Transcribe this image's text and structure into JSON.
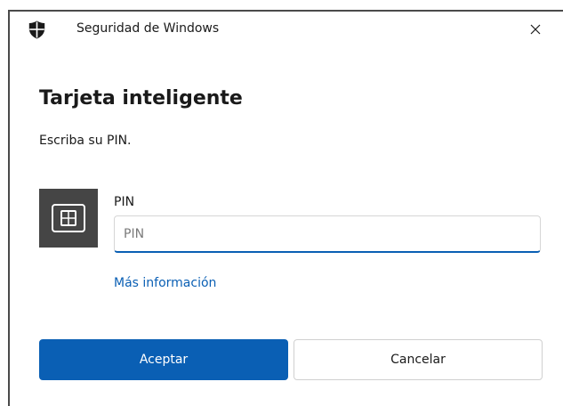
{
  "window": {
    "title": "Seguridad de Windows",
    "app_icon": "shield-icon",
    "close_icon": "close-icon"
  },
  "dialog": {
    "heading": "Tarjeta inteligente",
    "instruction": "Escriba su PIN."
  },
  "pin_field": {
    "label": "PIN",
    "placeholder": "PIN",
    "value": "",
    "tile_icon": "smart-card-icon"
  },
  "link": {
    "more_info": "Más información"
  },
  "buttons": {
    "ok_label": "Aceptar",
    "cancel_label": "Cancelar"
  },
  "colors": {
    "accent": "#0a5fb4",
    "tile": "#454545",
    "background": "#ffffff"
  }
}
